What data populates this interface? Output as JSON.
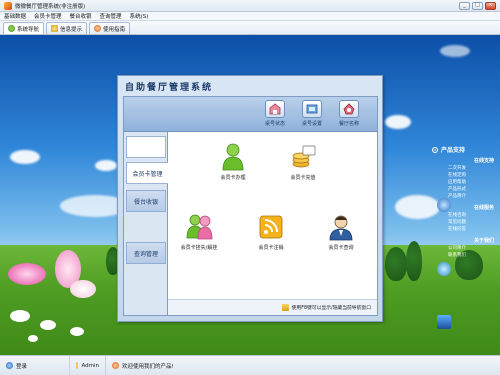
{
  "window": {
    "title": "微微餐厅管理系统(非注册版)",
    "controls": [
      "_",
      "□",
      "×"
    ]
  },
  "menu": [
    "基础数据",
    "会员卡管理",
    "餐台收银",
    "查询管理",
    "系统(S)"
  ],
  "tabs": [
    {
      "label": "系统导航",
      "icon": "home-icon"
    },
    {
      "label": "信息提示",
      "icon": "info-icon"
    },
    {
      "label": "使用指南",
      "icon": "guide-icon"
    }
  ],
  "panel": {
    "title": "自助餐厅管理系统",
    "toolbar": [
      {
        "label": "桌号状态",
        "icon": "table-status-icon"
      },
      {
        "label": "桌号设置",
        "icon": "table-setup-icon"
      },
      {
        "label": "餐厅名称",
        "icon": "restaurant-name-icon"
      }
    ],
    "nav": [
      {
        "label": "会员卡管理",
        "active": true
      },
      {
        "label": "餐台收银",
        "active": false
      },
      {
        "label": "查询管理",
        "active": false
      }
    ],
    "features": [
      {
        "label": "会员卡办理",
        "icon": "member-add-icon"
      },
      {
        "label": "会员卡充值",
        "icon": "recharge-icon"
      },
      {
        "label": "会员卡挂失/解挂",
        "icon": "lock-member-icon"
      },
      {
        "label": "会员卡注销",
        "icon": "rss-cancel-icon"
      },
      {
        "label": "会员卡查询",
        "icon": "member-query-icon"
      }
    ],
    "hint": "使用F8键可以显示/隐藏当前导航窗口"
  },
  "sidebar": {
    "header": "产品支持",
    "groups": [
      {
        "title": "在线支持",
        "items": [
          "二次开发",
          "在线定购",
          "应用帮助",
          "产品形式",
          "产品简介"
        ]
      },
      {
        "title": "在线服务",
        "items": [
          "在线咨询",
          "常见问题",
          "在线问答"
        ]
      },
      {
        "title": "关于我们",
        "items": [
          "公司简介",
          "联系我们"
        ]
      }
    ]
  },
  "status": {
    "user_label": "登录",
    "account": "Admin",
    "welcome": "欢迎使用我们的产品!"
  },
  "colors": {
    "panel_border": "#7f9cc4",
    "toolbar": "#8fb2db",
    "sky": "#2f86d8",
    "grass": "#4f9d23"
  }
}
